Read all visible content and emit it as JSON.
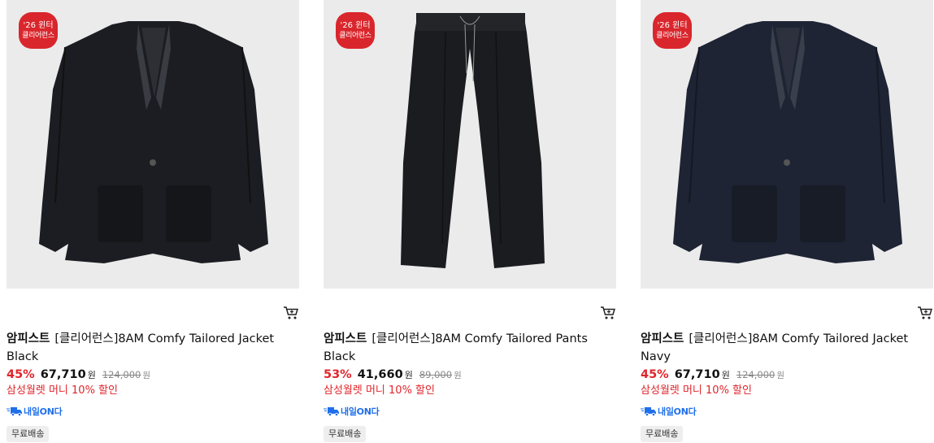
{
  "products": [
    {
      "badge": {
        "line1": "'26 윈터",
        "line2": "클리어런스"
      },
      "brand": "암피스트",
      "name": "[클리어런스]8AM Comfy Tailored Jacket Black",
      "discount": "45%",
      "price": "67,710",
      "currency": "원",
      "original_price": "124,000",
      "promo": "삼성월렛 머니 10% 할인",
      "delivery_label": "내일ON다",
      "shipping": "무료배송",
      "item_color": "#1c1d22",
      "item_type": "jacket"
    },
    {
      "badge": {
        "line1": "'26 윈터",
        "line2": "클리어런스"
      },
      "brand": "암피스트",
      "name": "[클리어런스]8AM Comfy Tailored Pants Black",
      "discount": "53%",
      "price": "41,660",
      "currency": "원",
      "original_price": "89,000",
      "promo": "삼성월렛 머니 10% 할인",
      "delivery_label": "내일ON다",
      "shipping": "무료배송",
      "item_color": "#1b1c20",
      "item_type": "pants"
    },
    {
      "badge": {
        "line1": "'26 윈터",
        "line2": "클리어런스"
      },
      "brand": "암피스트",
      "name": "[클리어런스]8AM Comfy Tailored Jacket Navy",
      "discount": "45%",
      "price": "67,710",
      "currency": "원",
      "original_price": "124,000",
      "promo": "삼성월렛 머니 10% 할인",
      "delivery_label": "내일ON다",
      "shipping": "무료배송",
      "item_color": "#1e2433",
      "item_type": "jacket"
    }
  ],
  "colors": {
    "accent_red": "#e0242a",
    "badge_red": "#d9262c",
    "delivery_blue": "#1f6feb",
    "thumb_bg": "#ebebeb"
  },
  "icons": {
    "cart": "cart-icon",
    "delivery": "truck-icon"
  }
}
